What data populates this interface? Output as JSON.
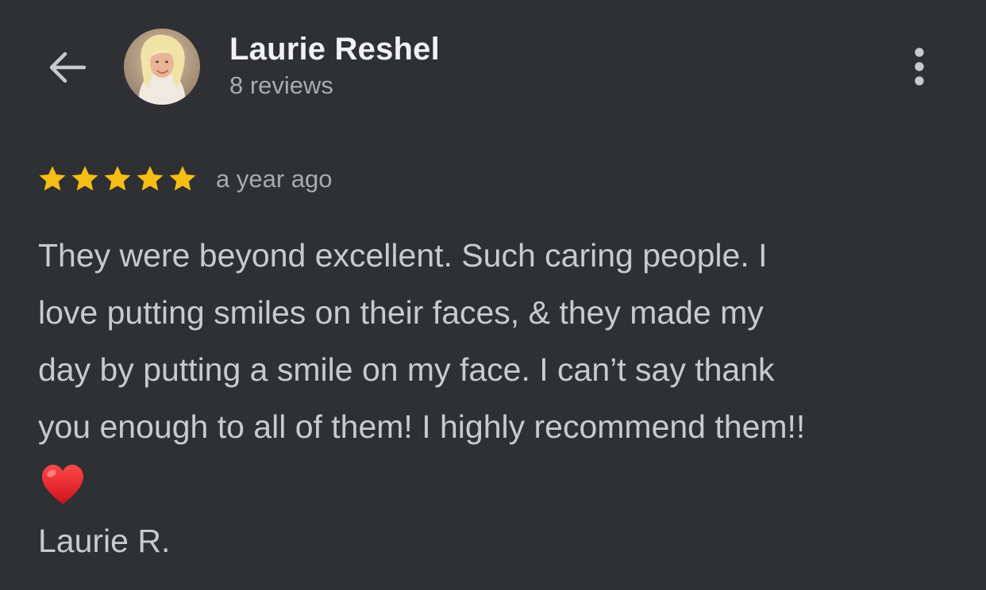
{
  "header": {
    "back_icon": "arrow-left-icon",
    "reviewer_name": "Laurie Reshel",
    "review_count": "8 reviews",
    "more_icon": "more-vertical-icon"
  },
  "review": {
    "rating": 5,
    "rating_max": 5,
    "star_color": "#f6bd16",
    "time_ago": "a year ago",
    "lines": [
      "They were beyond excellent. Such caring people. I",
      "love putting smiles on their faces, & they made my",
      "day by putting a smile on my face. I can’t say thank",
      "you enough to all of them! I highly recommend them!!"
    ],
    "emoji": "red-heart-icon",
    "signature": "Laurie R."
  },
  "colors": {
    "background": "#2f3033",
    "name_text": "#f1f1f3",
    "secondary_text": "#a9aaae",
    "body_text": "#c9cacd"
  }
}
